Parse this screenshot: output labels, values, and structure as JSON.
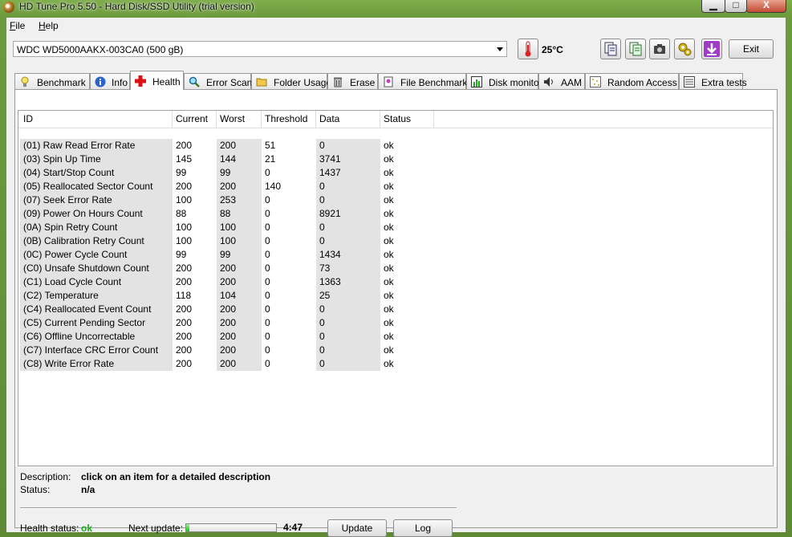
{
  "window": {
    "title": "HD Tune Pro 5.50 - Hard Disk/SSD Utility (trial version)",
    "minimize_label": "▁",
    "maximize_label": "□",
    "close_label": "X"
  },
  "menu": {
    "file": "File",
    "help": "Help"
  },
  "toolbar": {
    "drive": "WDC WD5000AAKX-003CA0 (500 gB)",
    "temperature": "25°C",
    "exit_label": "Exit"
  },
  "tabs": [
    {
      "label": "Benchmark",
      "icon": "lightbulb-icon"
    },
    {
      "label": "Info",
      "icon": "info-icon"
    },
    {
      "label": "Health",
      "icon": "red-cross-icon",
      "active": true
    },
    {
      "label": "Error Scan",
      "icon": "magnifier-icon"
    },
    {
      "label": "Folder Usage",
      "icon": "folder-icon"
    },
    {
      "label": "Erase",
      "icon": "trash-icon"
    },
    {
      "label": "File Benchmark",
      "icon": "file-benchmark-icon"
    },
    {
      "label": "Disk monitor",
      "icon": "chart-icon"
    },
    {
      "label": "AAM",
      "icon": "speaker-icon"
    },
    {
      "label": "Random Access",
      "icon": "random-access-icon"
    },
    {
      "label": "Extra tests",
      "icon": "extra-tests-icon"
    }
  ],
  "table": {
    "columns": [
      "ID",
      "Current",
      "Worst",
      "Threshold",
      "Data",
      "Status"
    ],
    "rows": [
      [
        "(01) Raw Read Error Rate",
        "200",
        "200",
        "51",
        "0",
        "ok"
      ],
      [
        "(03) Spin Up Time",
        "145",
        "144",
        "21",
        "3741",
        "ok"
      ],
      [
        "(04) Start/Stop Count",
        "99",
        "99",
        "0",
        "1437",
        "ok"
      ],
      [
        "(05) Reallocated Sector Count",
        "200",
        "200",
        "140",
        "0",
        "ok"
      ],
      [
        "(07) Seek Error Rate",
        "100",
        "253",
        "0",
        "0",
        "ok"
      ],
      [
        "(09) Power On Hours Count",
        "88",
        "88",
        "0",
        "8921",
        "ok"
      ],
      [
        "(0A) Spin Retry Count",
        "100",
        "100",
        "0",
        "0",
        "ok"
      ],
      [
        "(0B) Calibration Retry Count",
        "100",
        "100",
        "0",
        "0",
        "ok"
      ],
      [
        "(0C) Power Cycle Count",
        "99",
        "99",
        "0",
        "1434",
        "ok"
      ],
      [
        "(C0) Unsafe Shutdown Count",
        "200",
        "200",
        "0",
        "73",
        "ok"
      ],
      [
        "(C1) Load Cycle Count",
        "200",
        "200",
        "0",
        "1363",
        "ok"
      ],
      [
        "(C2) Temperature",
        "118",
        "104",
        "0",
        "25",
        "ok"
      ],
      [
        "(C4) Reallocated Event Count",
        "200",
        "200",
        "0",
        "0",
        "ok"
      ],
      [
        "(C5) Current Pending Sector",
        "200",
        "200",
        "0",
        "0",
        "ok"
      ],
      [
        "(C6) Offline Uncorrectable",
        "200",
        "200",
        "0",
        "0",
        "ok"
      ],
      [
        "(C7) Interface CRC Error Count",
        "200",
        "200",
        "0",
        "0",
        "ok"
      ],
      [
        "(C8) Write Error Rate",
        "200",
        "200",
        "0",
        "0",
        "ok"
      ]
    ]
  },
  "details": {
    "description_label": "Description:",
    "description_value": "click on an item for a detailed description",
    "status_label": "Status:",
    "status_value": "n/a",
    "health_label": "Health status:",
    "health_value": "ok",
    "health_color": "#22aa22",
    "next_update_label": "Next update:",
    "countdown": "4:47",
    "progress_fraction": 0.04,
    "update_label": "Update",
    "log_label": "Log"
  }
}
